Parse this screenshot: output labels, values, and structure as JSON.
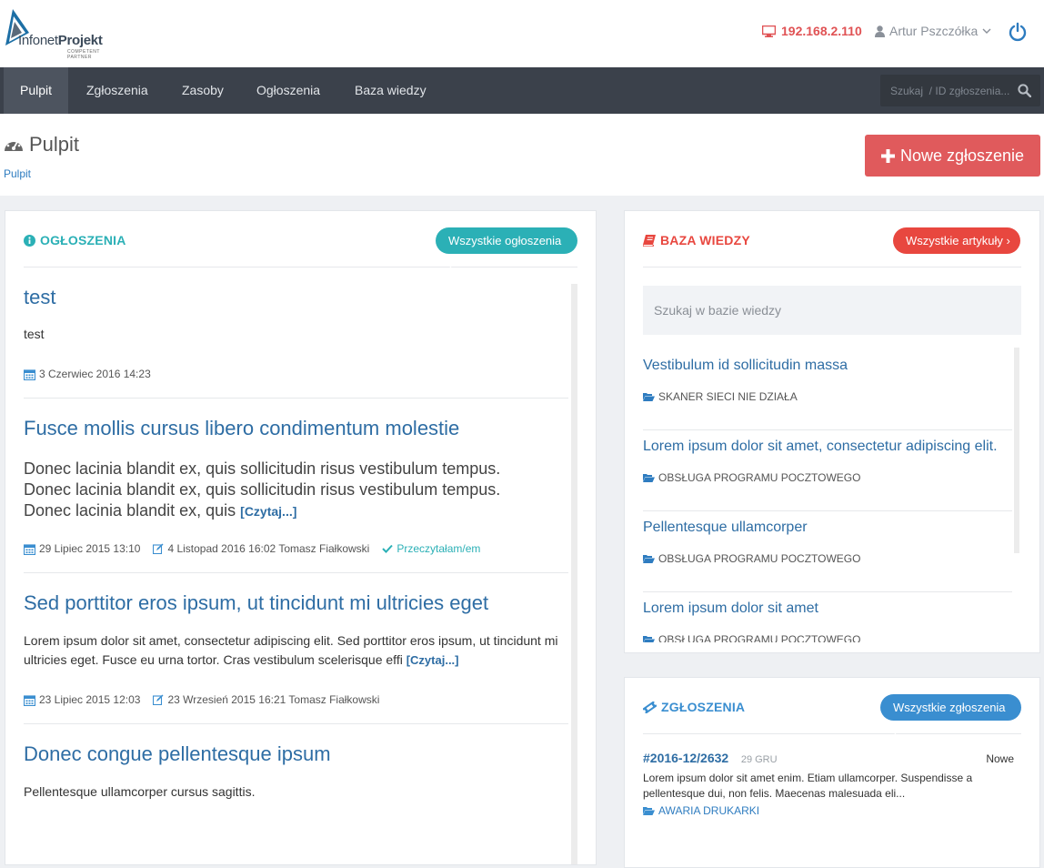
{
  "brand": {
    "name_light": "Infonet",
    "name_bold": "Projekt",
    "tagline": "COMPETENT PARTNER"
  },
  "header": {
    "ip": "192.168.2.110",
    "user": "Artur Pszczółka"
  },
  "nav": {
    "items": [
      {
        "label": "Pulpit",
        "active": true
      },
      {
        "label": "Zgłoszenia"
      },
      {
        "label": "Zasoby"
      },
      {
        "label": "Ogłoszenia"
      },
      {
        "label": "Baza wiedzy"
      }
    ],
    "search_placeholder": "Szukaj  / ID zgłoszenia..."
  },
  "page": {
    "title": "Pulpit",
    "breadcrumb": "Pulpit",
    "new_button": "Nowe zgłoszenie"
  },
  "announcements": {
    "title": "OGŁOSZENIA",
    "all_button": "Wszystkie ogłoszenia",
    "items": [
      {
        "title": "test",
        "body": "test",
        "date": "3 Czerwiec 2016 14:23"
      },
      {
        "title": "Fusce mollis cursus libero condimentum molestie",
        "body": "Donec lacinia blandit ex, quis sollicitudin risus vestibulum tempus. Donec lacinia blandit ex, quis sollicitudin risus vestibulum tempus. Donec lacinia blandit ex, quis",
        "readmore": "[Czytaj...]",
        "date": "29 Lipiec 2015 13:10",
        "edited": "4 Listopad 2016 16:02 Tomasz Fiałkowski",
        "read": "Przeczytałam/em"
      },
      {
        "title": "Sed porttitor eros ipsum, ut tincidunt mi ultricies eget",
        "body": "Lorem ipsum dolor sit amet, consectetur adipiscing elit. Sed porttitor eros ipsum, ut tincidunt mi ultricies eget. Fusce eu urna tortor. Cras vestibulum scelerisque effi",
        "readmore": "[Czytaj...]",
        "date": "23 Lipiec 2015 12:03",
        "edited": "23 Wrzesień 2015 16:21 Tomasz Fiałkowski"
      },
      {
        "title": "Donec congue pellentesque ipsum",
        "body": "Pellentesque ullamcorper cursus sagittis."
      }
    ]
  },
  "kb": {
    "title": "BAZA WIEDZY",
    "all_button": "Wszystkie artykuły",
    "search_placeholder": "Szukaj w bazie wiedzy",
    "items": [
      {
        "title": "Vestibulum id sollicitudin massa",
        "category": "SKANER SIECI NIE DZIAŁA"
      },
      {
        "title": "Lorem ipsum dolor sit amet, consectetur adipiscing elit.",
        "category": "OBSŁUGA PROGRAMU POCZTOWEGO"
      },
      {
        "title": "Pellentesque ullamcorper",
        "category": "OBSŁUGA PROGRAMU POCZTOWEGO"
      },
      {
        "title": "Lorem ipsum dolor sit amet",
        "category": "OBSŁUGA PROGRAMU POCZTOWEGO"
      }
    ]
  },
  "tickets": {
    "title": "ZGŁOSZENIA",
    "all_button": "Wszystkie zgłoszenia",
    "items": [
      {
        "id": "#2016-12/2632",
        "date": "29 GRU",
        "status": "Nowe",
        "body": "Lorem ipsum dolor sit amet enim. Etiam ullamcorper. Suspendisse a pellentesque dui, non felis. Maecenas malesuada eli...",
        "category": "AWARIA DRUKARKI"
      }
    ]
  },
  "colors": {
    "accent_teal": "#2bb0b6",
    "accent_red": "#e8473f",
    "accent_blue": "#3a8ed0",
    "link": "#2e6da4",
    "nav_bg": "#3b414b"
  }
}
